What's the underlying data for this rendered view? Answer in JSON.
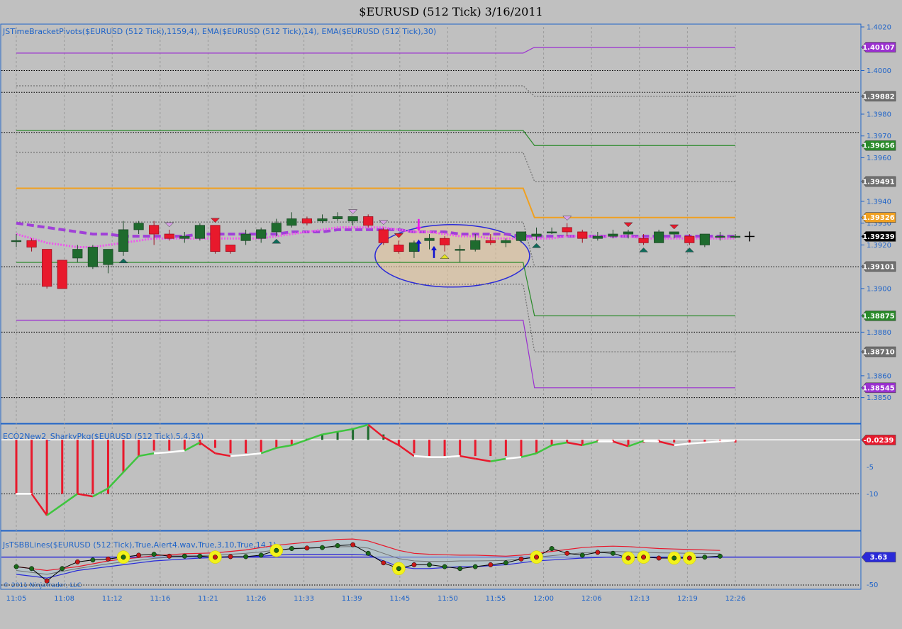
{
  "title": "$EURUSD (512 Tick)  3/16/2011",
  "panel1_label": "JSTimeBracketPivots($EURUSD (512 Tick),1159,4), EMA($EURUSD (512 Tick),14), EMA($EURUSD (512 Tick),30)",
  "panel2_label": "ECO2New2_SharkyPkg($EURUSD (512 Tick),5,4,34)",
  "panel3_label": "JsTSBBLines($EURUSD (512 Tick),True,Alert4.wav,True,3,10,True,14,1)",
  "copyright": "© 2011 NinjaTrader, LLC",
  "colors": {
    "background": "#c0c0c0",
    "axis": "#1e63c8",
    "up": "#1f6b2e",
    "down": "#e8192c",
    "ema_fast": "#ee55ee",
    "ema_slow": "#a040d8",
    "purple": "#9b30d0",
    "green": "#2a8a2a",
    "orange": "#f0a020",
    "gray": "#707070"
  },
  "chart_data": [
    {
      "type": "candlestick",
      "panel": "price",
      "ylim": [
        1.3845,
        1.402
      ],
      "y_ticks": [
        "1.4020",
        "1.4000",
        "1.3980",
        "1.3970",
        "1.3960",
        "1.3940",
        "1.3930",
        "1.3920",
        "1.3900",
        "1.3880",
        "1.3860",
        "1.3850"
      ],
      "x_ticks": [
        "11:05",
        "11:08",
        "11:12",
        "11:16",
        "11:21",
        "11:26",
        "11:33",
        "11:39",
        "11:45",
        "11:50",
        "11:55",
        "12:00",
        "12:06",
        "12:13",
        "12:19",
        "12:26"
      ],
      "price_tags": [
        {
          "label": "1.40107",
          "value": 1.40107,
          "color": "#9b30d0"
        },
        {
          "label": "1.39882",
          "value": 1.39882,
          "color": "#707070"
        },
        {
          "label": "1.39656",
          "value": 1.39656,
          "color": "#2a8a2a"
        },
        {
          "label": "1.39491",
          "value": 1.39491,
          "color": "#707070"
        },
        {
          "label": "1.39326",
          "value": 1.39326,
          "color": "#f0a020"
        },
        {
          "label": "1.39239",
          "value": 1.39239,
          "color": "#000000"
        },
        {
          "label": "1.39101",
          "value": 1.39101,
          "color": "#707070"
        },
        {
          "label": "1.38875",
          "value": 1.38875,
          "color": "#2a8a2a"
        },
        {
          "label": "1.38710",
          "value": 1.3871,
          "color": "#707070"
        },
        {
          "label": "1.38545",
          "value": 1.38545,
          "color": "#9b30d0"
        }
      ],
      "pivot_levels": [
        {
          "name": "purple_upper",
          "before": 1.4008,
          "after": 1.40107,
          "color": "#9b30d0",
          "style": "solid"
        },
        {
          "name": "gray_r2",
          "before": 1.3993,
          "after": 1.39882,
          "color": "#707070",
          "style": "dotted"
        },
        {
          "name": "green_upper",
          "before": 1.39725,
          "after": 1.39656,
          "color": "#2a8a2a",
          "style": "solid"
        },
        {
          "name": "gray_r1",
          "before": 1.39625,
          "after": 1.39491,
          "color": "#707070",
          "style": "dotted"
        },
        {
          "name": "orange_pivot",
          "before": 1.3946,
          "after": 1.39326,
          "color": "#f0a020",
          "style": "solid"
        },
        {
          "name": "gray_s1",
          "before": 1.39305,
          "after": 1.39101,
          "color": "#707070",
          "style": "dotted"
        },
        {
          "name": "green_lower",
          "before": 1.3912,
          "after": 1.38875,
          "color": "#2a8a2a",
          "style": "solid"
        },
        {
          "name": "gray_s2",
          "before": 1.3902,
          "after": 1.3871,
          "color": "#707070",
          "style": "dotted"
        },
        {
          "name": "purple_lower",
          "before": 1.38855,
          "after": 1.38545,
          "color": "#9b30d0",
          "style": "solid"
        }
      ],
      "black_dotted_levels": [
        1.4,
        1.39716,
        1.399,
        1.391,
        1.388,
        1.385
      ],
      "candles": [
        {
          "o": 1.3922,
          "h": 1.3925,
          "l": 1.3919,
          "c": 1.3922
        },
        {
          "o": 1.3922,
          "h": 1.3923,
          "l": 1.3917,
          "c": 1.3919
        },
        {
          "o": 1.3918,
          "h": 1.3918,
          "l": 1.39,
          "c": 1.3901
        },
        {
          "o": 1.3913,
          "h": 1.3913,
          "l": 1.39,
          "c": 1.39
        },
        {
          "o": 1.3914,
          "h": 1.392,
          "l": 1.3912,
          "c": 1.3918
        },
        {
          "o": 1.391,
          "h": 1.392,
          "l": 1.3909,
          "c": 1.3919
        },
        {
          "o": 1.3911,
          "h": 1.3918,
          "l": 1.3907,
          "c": 1.3918
        },
        {
          "o": 1.3917,
          "h": 1.3931,
          "l": 1.3915,
          "c": 1.3927
        },
        {
          "o": 1.3927,
          "h": 1.3931,
          "l": 1.3925,
          "c": 1.393
        },
        {
          "o": 1.3929,
          "h": 1.3931,
          "l": 1.392,
          "c": 1.3925
        },
        {
          "o": 1.3925,
          "h": 1.3927,
          "l": 1.3922,
          "c": 1.3923
        },
        {
          "o": 1.3923,
          "h": 1.3926,
          "l": 1.3921,
          "c": 1.3924
        },
        {
          "o": 1.3923,
          "h": 1.393,
          "l": 1.3922,
          "c": 1.3929
        },
        {
          "o": 1.3929,
          "h": 1.3929,
          "l": 1.3916,
          "c": 1.3917
        },
        {
          "o": 1.392,
          "h": 1.392,
          "l": 1.3916,
          "c": 1.3917
        },
        {
          "o": 1.3922,
          "h": 1.3927,
          "l": 1.392,
          "c": 1.3925
        },
        {
          "o": 1.3923,
          "h": 1.3928,
          "l": 1.3921,
          "c": 1.3927
        },
        {
          "o": 1.3926,
          "h": 1.3932,
          "l": 1.3924,
          "c": 1.393
        },
        {
          "o": 1.3929,
          "h": 1.3935,
          "l": 1.3928,
          "c": 1.3932
        },
        {
          "o": 1.3932,
          "h": 1.3933,
          "l": 1.3929,
          "c": 1.393
        },
        {
          "o": 1.3931,
          "h": 1.3934,
          "l": 1.393,
          "c": 1.3932
        },
        {
          "o": 1.3932,
          "h": 1.3935,
          "l": 1.3931,
          "c": 1.3933
        },
        {
          "o": 1.3931,
          "h": 1.3933,
          "l": 1.3929,
          "c": 1.3933
        },
        {
          "o": 1.3933,
          "h": 1.3934,
          "l": 1.3928,
          "c": 1.3929
        },
        {
          "o": 1.3927,
          "h": 1.3928,
          "l": 1.392,
          "c": 1.3921
        },
        {
          "o": 1.392,
          "h": 1.3922,
          "l": 1.3916,
          "c": 1.3917
        },
        {
          "o": 1.3917,
          "h": 1.3922,
          "l": 1.3914,
          "c": 1.3921
        },
        {
          "o": 1.3922,
          "h": 1.3925,
          "l": 1.3918,
          "c": 1.3923
        },
        {
          "o": 1.3923,
          "h": 1.3924,
          "l": 1.3917,
          "c": 1.392
        },
        {
          "o": 1.3918,
          "h": 1.392,
          "l": 1.3912,
          "c": 1.3918
        },
        {
          "o": 1.3918,
          "h": 1.3925,
          "l": 1.3917,
          "c": 1.3922
        },
        {
          "o": 1.3922,
          "h": 1.3925,
          "l": 1.392,
          "c": 1.3921
        },
        {
          "o": 1.3921,
          "h": 1.3923,
          "l": 1.3919,
          "c": 1.3922
        },
        {
          "o": 1.3922,
          "h": 1.3926,
          "l": 1.3921,
          "c": 1.3926
        },
        {
          "o": 1.3924,
          "h": 1.3928,
          "l": 1.3922,
          "c": 1.3925
        },
        {
          "o": 1.3926,
          "h": 1.3928,
          "l": 1.3925,
          "c": 1.3926
        },
        {
          "o": 1.3928,
          "h": 1.393,
          "l": 1.3924,
          "c": 1.3926
        },
        {
          "o": 1.3926,
          "h": 1.3927,
          "l": 1.3921,
          "c": 1.3923
        },
        {
          "o": 1.3923,
          "h": 1.3926,
          "l": 1.3922,
          "c": 1.3924
        },
        {
          "o": 1.3924,
          "h": 1.3927,
          "l": 1.3923,
          "c": 1.3925
        },
        {
          "o": 1.3925,
          "h": 1.3927,
          "l": 1.3923,
          "c": 1.3926
        },
        {
          "o": 1.3923,
          "h": 1.3925,
          "l": 1.392,
          "c": 1.3921
        },
        {
          "o": 1.3921,
          "h": 1.3927,
          "l": 1.3921,
          "c": 1.3926
        },
        {
          "o": 1.3925,
          "h": 1.3926,
          "l": 1.3923,
          "c": 1.3926
        },
        {
          "o": 1.3924,
          "h": 1.3925,
          "l": 1.392,
          "c": 1.3921
        },
        {
          "o": 1.392,
          "h": 1.3925,
          "l": 1.3919,
          "c": 1.3925
        },
        {
          "o": 1.3924,
          "h": 1.3926,
          "l": 1.3922,
          "c": 1.3924
        },
        {
          "o": 1.3924,
          "h": 1.3925,
          "l": 1.3923,
          "c": 1.3924
        }
      ],
      "ema_fast": [
        1.3925,
        1.3923,
        1.3921,
        1.392,
        1.3919,
        1.3919,
        1.392,
        1.3921,
        1.3922,
        1.3923,
        1.3923,
        1.3923,
        1.3923,
        1.3923,
        1.3923,
        1.3923,
        1.3923,
        1.3924,
        1.3925,
        1.3926,
        1.3927,
        1.3928,
        1.3928,
        1.3928,
        1.3928,
        1.3927,
        1.3926,
        1.3926,
        1.3925,
        1.3924,
        1.3924,
        1.3923,
        1.3923,
        1.3923,
        1.3923,
        1.3923,
        1.3924,
        1.3924,
        1.3924,
        1.3924,
        1.3924,
        1.3923,
        1.3923,
        1.3923,
        1.3923,
        1.3923,
        1.3923,
        1.3923
      ],
      "ema_slow": [
        1.393,
        1.3929,
        1.3928,
        1.3927,
        1.3926,
        1.3925,
        1.3925,
        1.3924,
        1.3924,
        1.3924,
        1.3924,
        1.3924,
        1.3925,
        1.3925,
        1.3925,
        1.3925,
        1.3925,
        1.3925,
        1.3926,
        1.3926,
        1.3926,
        1.3927,
        1.3927,
        1.3927,
        1.3927,
        1.3927,
        1.3926,
        1.3926,
        1.3926,
        1.3925,
        1.3925,
        1.3925,
        1.3925,
        1.3924,
        1.3924,
        1.3924,
        1.3924,
        1.3924,
        1.3924,
        1.3924,
        1.3924,
        1.3924,
        1.3924,
        1.3924,
        1.3924,
        1.3924,
        1.3924,
        1.3924
      ],
      "markers": [
        {
          "bar": 7,
          "type": "up-triangle",
          "color": "#0e6b5a",
          "pos": "below"
        },
        {
          "bar": 10,
          "type": "down-triangle",
          "color": "#d7a0e8",
          "pos": "above"
        },
        {
          "bar": 13,
          "type": "down-triangle",
          "color": "#e8192c",
          "pos": "above"
        },
        {
          "bar": 17,
          "type": "up-triangle",
          "color": "#0e6b5a",
          "pos": "below"
        },
        {
          "bar": 22,
          "type": "down-triangle",
          "color": "#d7a0e8",
          "pos": "above"
        },
        {
          "bar": 24,
          "type": "down-triangle",
          "color": "#d7a0e8",
          "pos": "above"
        },
        {
          "bar": 25,
          "type": "down-triangle",
          "color": "#e8192c",
          "pos": "above"
        },
        {
          "bar": 28,
          "type": "up-triangle",
          "color": "#e0e020",
          "pos": "below"
        },
        {
          "bar": 34,
          "type": "up-triangle",
          "color": "#0e6b5a",
          "pos": "below"
        },
        {
          "bar": 36,
          "type": "down-triangle",
          "color": "#d7a0e8",
          "pos": "above"
        },
        {
          "bar": 40,
          "type": "down-triangle",
          "color": "#e8192c",
          "pos": "above"
        },
        {
          "bar": 41,
          "type": "up-triangle",
          "color": "#0e6b5a",
          "pos": "below"
        },
        {
          "bar": 43,
          "type": "down-triangle",
          "color": "#e8192c",
          "pos": "above"
        },
        {
          "bar": 44,
          "type": "up-triangle",
          "color": "#0e6b5a",
          "pos": "below"
        }
      ]
    },
    {
      "type": "bar",
      "panel": "oscillator",
      "ylim": [
        -16,
        2
      ],
      "y_ticks": [
        "-0.0239",
        "-5",
        "-10"
      ],
      "histogram": [
        -10,
        -10,
        -14,
        -10,
        -10,
        -10,
        -10,
        -6,
        -3,
        -2,
        -2,
        -1.8,
        -1,
        -1.5,
        -2.5,
        -2.5,
        -2.2,
        -1.5,
        -1,
        0.2,
        1,
        1.5,
        2,
        2.5,
        1,
        -1,
        -2.5,
        -3,
        -3,
        -3,
        -3,
        -3,
        -3,
        -3,
        -2.5,
        -1,
        -0.5,
        -1,
        -0.5,
        -0.5,
        -1,
        -0.5,
        -0.5,
        -0.5,
        -0.5,
        -0.5,
        -0.5,
        -0.5
      ],
      "line": [
        -10,
        -10,
        -14,
        -12,
        -10,
        -10.5,
        -9,
        -6,
        -3,
        -2.5,
        -2.3,
        -2,
        -0.5,
        -2.5,
        -3,
        -2.8,
        -2.5,
        -1.5,
        -1,
        0,
        1,
        1.5,
        2,
        2.8,
        0.5,
        -1,
        -3,
        -3.2,
        -3.2,
        -3,
        -3.5,
        -4,
        -3.5,
        -3.2,
        -2.5,
        -1,
        -0.5,
        -1,
        -0.3,
        -0.3,
        -1.2,
        -0.2,
        -0.3,
        -1,
        -0.7,
        -0.5,
        -0.3,
        -0.1
      ]
    },
    {
      "type": "line",
      "panel": "bands",
      "y_ticks": [
        "3.63",
        "-50"
      ],
      "upper": [
        -10,
        -12,
        -14,
        -12,
        -10,
        -7,
        -4,
        -2,
        -0.5,
        1.5,
        2.5,
        3.5,
        4,
        4.5,
        6,
        7.5,
        10,
        12.5,
        14,
        15.5,
        17,
        18.5,
        19,
        17,
        12,
        7,
        4,
        3,
        2.5,
        2,
        2,
        1.5,
        1,
        2,
        4,
        6,
        8,
        10,
        11,
        11.5,
        11,
        10,
        9,
        8.5,
        8,
        7.5,
        7
      ],
      "lower": [
        -18,
        -20,
        -22,
        -18,
        -14,
        -12,
        -10,
        -8,
        -6,
        -4,
        -3,
        -2,
        -1,
        -0.5,
        0,
        0.5,
        1,
        2,
        3,
        3,
        3,
        3,
        3,
        2,
        -4,
        -10,
        -12,
        -12,
        -11,
        -10,
        -10,
        -9,
        -8,
        -6,
        -4,
        -3,
        -2,
        -1,
        -0.5,
        0,
        0,
        0,
        0,
        0,
        0,
        0,
        0
      ],
      "mid": [
        -14,
        -16,
        -18,
        -15,
        -12,
        -9.5,
        -7,
        -5,
        -3.3,
        -1.3,
        -0.3,
        0.8,
        1.5,
        2,
        3,
        4,
        5.5,
        7.3,
        8.5,
        9.3,
        10,
        10.8,
        11,
        9.5,
        4,
        -1.5,
        -4,
        -4.5,
        -4.5,
        -4,
        -4,
        -3.8,
        -3.5,
        -2,
        0,
        1.5,
        3,
        4.5,
        5.3,
        5.8,
        5.5,
        5,
        4.5,
        4.3,
        4,
        3.8,
        3.5
      ],
      "dots": [
        -10,
        -12,
        -25,
        -12,
        -5,
        -3,
        -2,
        0,
        2,
        3,
        1,
        1,
        1,
        0,
        0.5,
        0.5,
        2,
        7,
        9,
        9.5,
        10,
        12,
        13,
        4,
        -6,
        -12,
        -8,
        -8,
        -10,
        -12,
        -10,
        -8,
        -6,
        -2,
        0,
        9,
        4,
        2,
        5,
        4,
        -1,
        0,
        -1,
        -1,
        -1,
        0,
        1
      ],
      "dot_colors": [
        "g",
        "g",
        "r",
        "g",
        "r",
        "g",
        "r",
        "g",
        "r",
        "g",
        "r",
        "g",
        "g",
        "r",
        "r",
        "g",
        "g",
        "g",
        "g",
        "r",
        "g",
        "g",
        "r",
        "g",
        "r",
        "g",
        "r",
        "g",
        "g",
        "g",
        "g",
        "r",
        "g",
        "r",
        "r",
        "g",
        "r",
        "g",
        "r",
        "g",
        "r",
        "r",
        "r",
        "g",
        "r",
        "g",
        "g"
      ],
      "highlight_bars": [
        7,
        13,
        17,
        25,
        34,
        40,
        41,
        43,
        44
      ]
    }
  ]
}
